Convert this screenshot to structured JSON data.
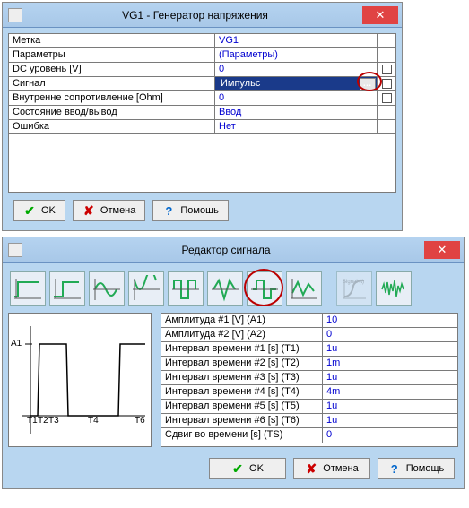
{
  "window1": {
    "title": "VG1 - Генератор напряжения",
    "rows": [
      {
        "label": "Метка",
        "value": "VG1",
        "chk": false
      },
      {
        "label": "Параметры",
        "value": "(Параметры)",
        "chk": false
      },
      {
        "label": "DC уровень [V]",
        "value": "0",
        "chk": true
      },
      {
        "label": "Сигнал",
        "value": "Импульс",
        "chk": true,
        "selected": true,
        "dots": true
      },
      {
        "label": "Внутренне сопротивление [Ohm]",
        "value": "0",
        "chk": true
      },
      {
        "label": "Состояние ввод/вывод",
        "value": "Ввод",
        "chk": false
      },
      {
        "label": "Ошибка",
        "value": "Нет",
        "chk": false
      }
    ],
    "buttons": {
      "ok": "OK",
      "cancel": "Отмена",
      "help": "Помощь"
    }
  },
  "window2": {
    "title": "Редактор сигнала",
    "preview": {
      "a1": "A1",
      "t1": "T1",
      "t2": "T2",
      "t3": "T3",
      "t4": "T4",
      "t6": "T6"
    },
    "rows": [
      {
        "label": "Амплитуда #1 [V] (A1)",
        "value": "10"
      },
      {
        "label": "Амплитуда #2 [V] (A2)",
        "value": "0"
      },
      {
        "label": "Интервал времени #1 [s] (T1)",
        "value": "1u"
      },
      {
        "label": "Интервал времени #2 [s] (T2)",
        "value": "1m"
      },
      {
        "label": "Интервал времени #3 [s] (T3)",
        "value": "1u"
      },
      {
        "label": "Интервал времени #4 [s] (T4)",
        "value": "4m"
      },
      {
        "label": "Интервал времени #5 [s] (T5)",
        "value": "1u"
      },
      {
        "label": "Интервал времени #6 [s] (T6)",
        "value": "1u"
      },
      {
        "label": "Сдвиг во времени [s] (TS)",
        "value": "0"
      }
    ],
    "buttons": {
      "ok": "OK",
      "cancel": "Отмена",
      "help": "Помощь"
    },
    "signal_label": "Signal (t)"
  }
}
